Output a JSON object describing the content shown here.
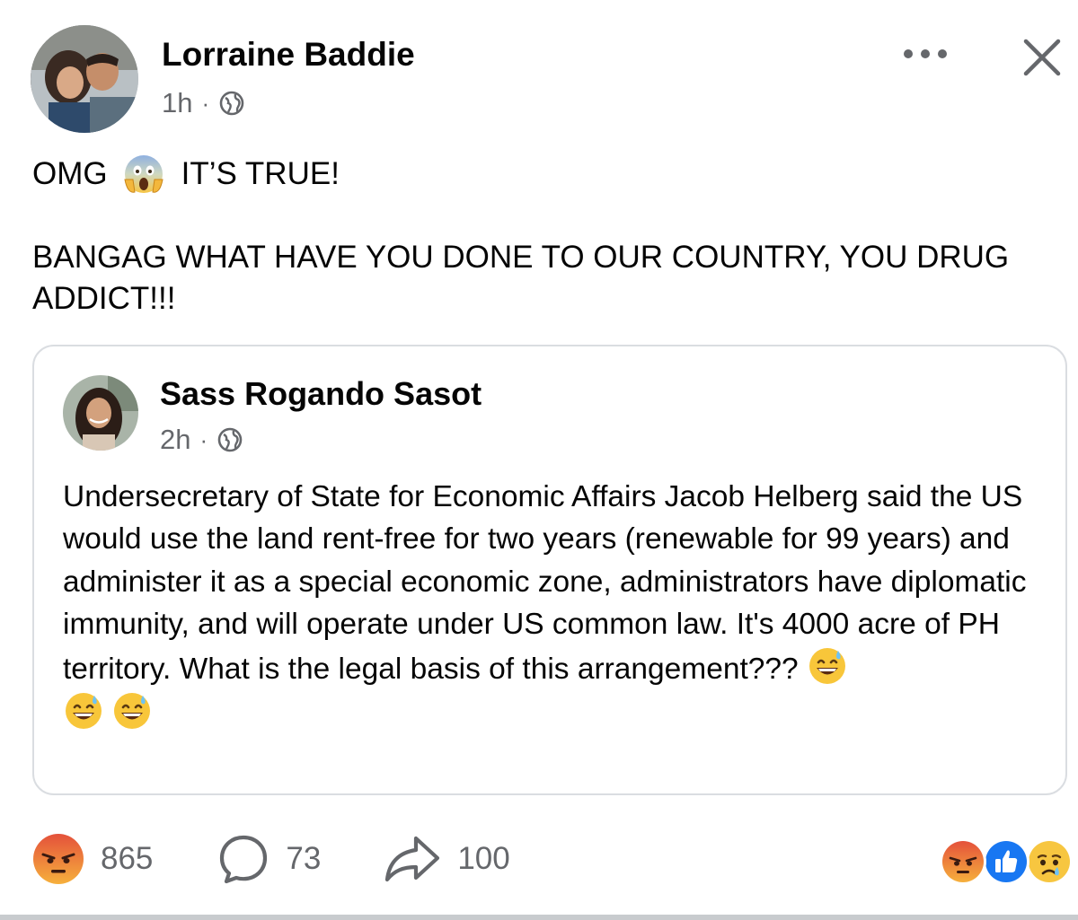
{
  "post": {
    "author": "Lorraine Baddie",
    "time": "1h",
    "separator": "·",
    "audience_icon": "globe-icon",
    "line1_before": "OMG",
    "line1_emoji": "face-screaming-in-fear-emoji",
    "line1_after": "IT’S TRUE!",
    "line2": "BANGAG WHAT HAVE YOU DONE TO OUR COUNTRY, YOU DRUG ADDICT!!!"
  },
  "shared": {
    "author": "Sass Rogando Sasot",
    "time": "2h",
    "separator": "·",
    "audience_icon": "globe-icon",
    "text": "Undersecretary of State for Economic Affairs Jacob Helberg said the US would use the land rent-free for two years (renewable for 99 years) and administer it as a special economic zone, administrators have diplomatic immunity, and will operate under US common law. It's 4000 acre of PH territory. What is the legal basis of this arrangement???",
    "trailing_emoji": "grinning-face-with-sweat-emoji"
  },
  "footer": {
    "reaction_icon": "angry-emoji",
    "reaction_count": "865",
    "comment_icon": "comment-icon",
    "comment_count": "73",
    "share_icon": "share-icon",
    "share_count": "100"
  },
  "reaction_summary": [
    "angry",
    "like",
    "sad"
  ],
  "colors": {
    "text": "#050505",
    "muted": "#65676b",
    "border": "#dadde1",
    "like_blue": "#1877f2",
    "angry_top": "#e4513b",
    "angry_bottom": "#f6b03c"
  }
}
